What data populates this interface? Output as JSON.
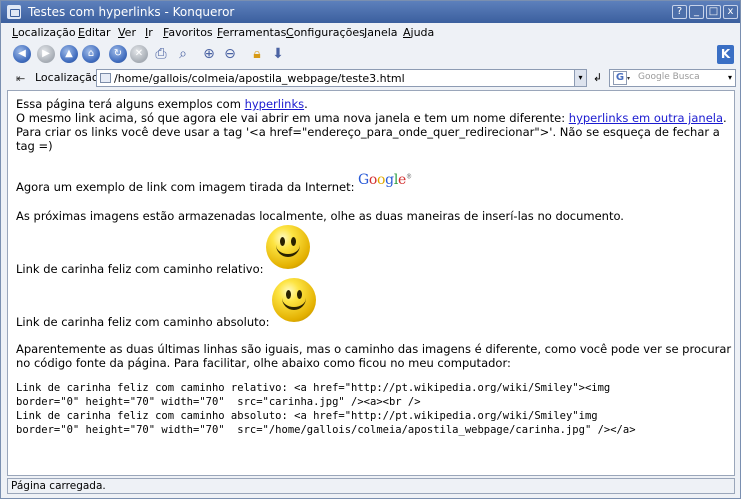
{
  "window": {
    "title": "Testes com hyperlinks - Konqueror",
    "buttons": [
      "?",
      "_",
      "□",
      "x"
    ]
  },
  "menubar": [
    {
      "mnemonic": "L",
      "rest": "ocalização"
    },
    {
      "mnemonic": "E",
      "rest": "ditar"
    },
    {
      "mnemonic": "V",
      "rest": "er"
    },
    {
      "mnemonic": "I",
      "rest": "r"
    },
    {
      "mnemonic": "F",
      "rest": "avoritos"
    },
    {
      "mnemonic": "F",
      "rest": "erramentas"
    },
    {
      "mnemonic": "C",
      "rest": "onfigurações"
    },
    {
      "mnemonic": "J",
      "rest": "anela"
    },
    {
      "mnemonic": "A",
      "rest": "juda"
    }
  ],
  "toolbar_icons": [
    "back-icon",
    "forward-icon",
    "up-icon",
    "home-icon",
    "reload-icon",
    "stop-icon",
    "print-icon",
    "find-icon",
    "zoom-in-icon",
    "zoom-out-icon",
    "lock-icon",
    "download-icon"
  ],
  "location": {
    "label": "Localização:",
    "url": "/home/gallois/colmeia/apostila_webpage/teste3.html",
    "search_placeholder": "Google Busca"
  },
  "content": {
    "line1_pre": "Essa página terá alguns exemplos com ",
    "line1_link": "hyperlinks",
    "line1_post": ".",
    "line2_pre": "O mesmo link acima, só que agora ele vai abrir em uma nova janela e tem um nome diferente: ",
    "line2_link": "hyperlinks em outra janela",
    "line2_post": ".",
    "line3": "Para criar os links você deve usar a tag '<a href=\"endereço_para_onde_quer_redirecionar\">'. Não se esqueça de fechar a",
    "line4": "tag =)",
    "google_text": "Agora um exemplo de link com imagem tirada da Internet:",
    "google_logo": "Google",
    "images_text": "As próximas imagens estão armazenadas localmente, olhe as duas maneiras de inserí-las no documento.",
    "relative_text": "Link de carinha feliz com caminho relativo:",
    "absolute_text": "Link de carinha feliz com caminho absoluto:",
    "para1": "Aparentemente as duas últimas linhas são iguais, mas o caminho das imagens é diferente, como você pode ver se procurar",
    "para2": "no código fonte da página. Para facilitar, olhe abaixo como ficou no meu computador:",
    "code1": "Link de carinha feliz com caminho relativo: <a href=\"http://pt.wikipedia.org/wiki/Smiley\"><img",
    "code2": "border=\"0\" height=\"70\" width=\"70\"  src=\"carinha.jpg\" /><a><br />",
    "code3": "Link de carinha feliz com caminho absoluto: <a href=\"http://pt.wikipedia.org/wiki/Smiley\"img",
    "code4": "border=\"0\" height=\"70\" width=\"70\"  src=\"/home/gallois/colmeia/apostila_webpage/carinha.jpg\" /></a>"
  },
  "status": "Página carregada."
}
